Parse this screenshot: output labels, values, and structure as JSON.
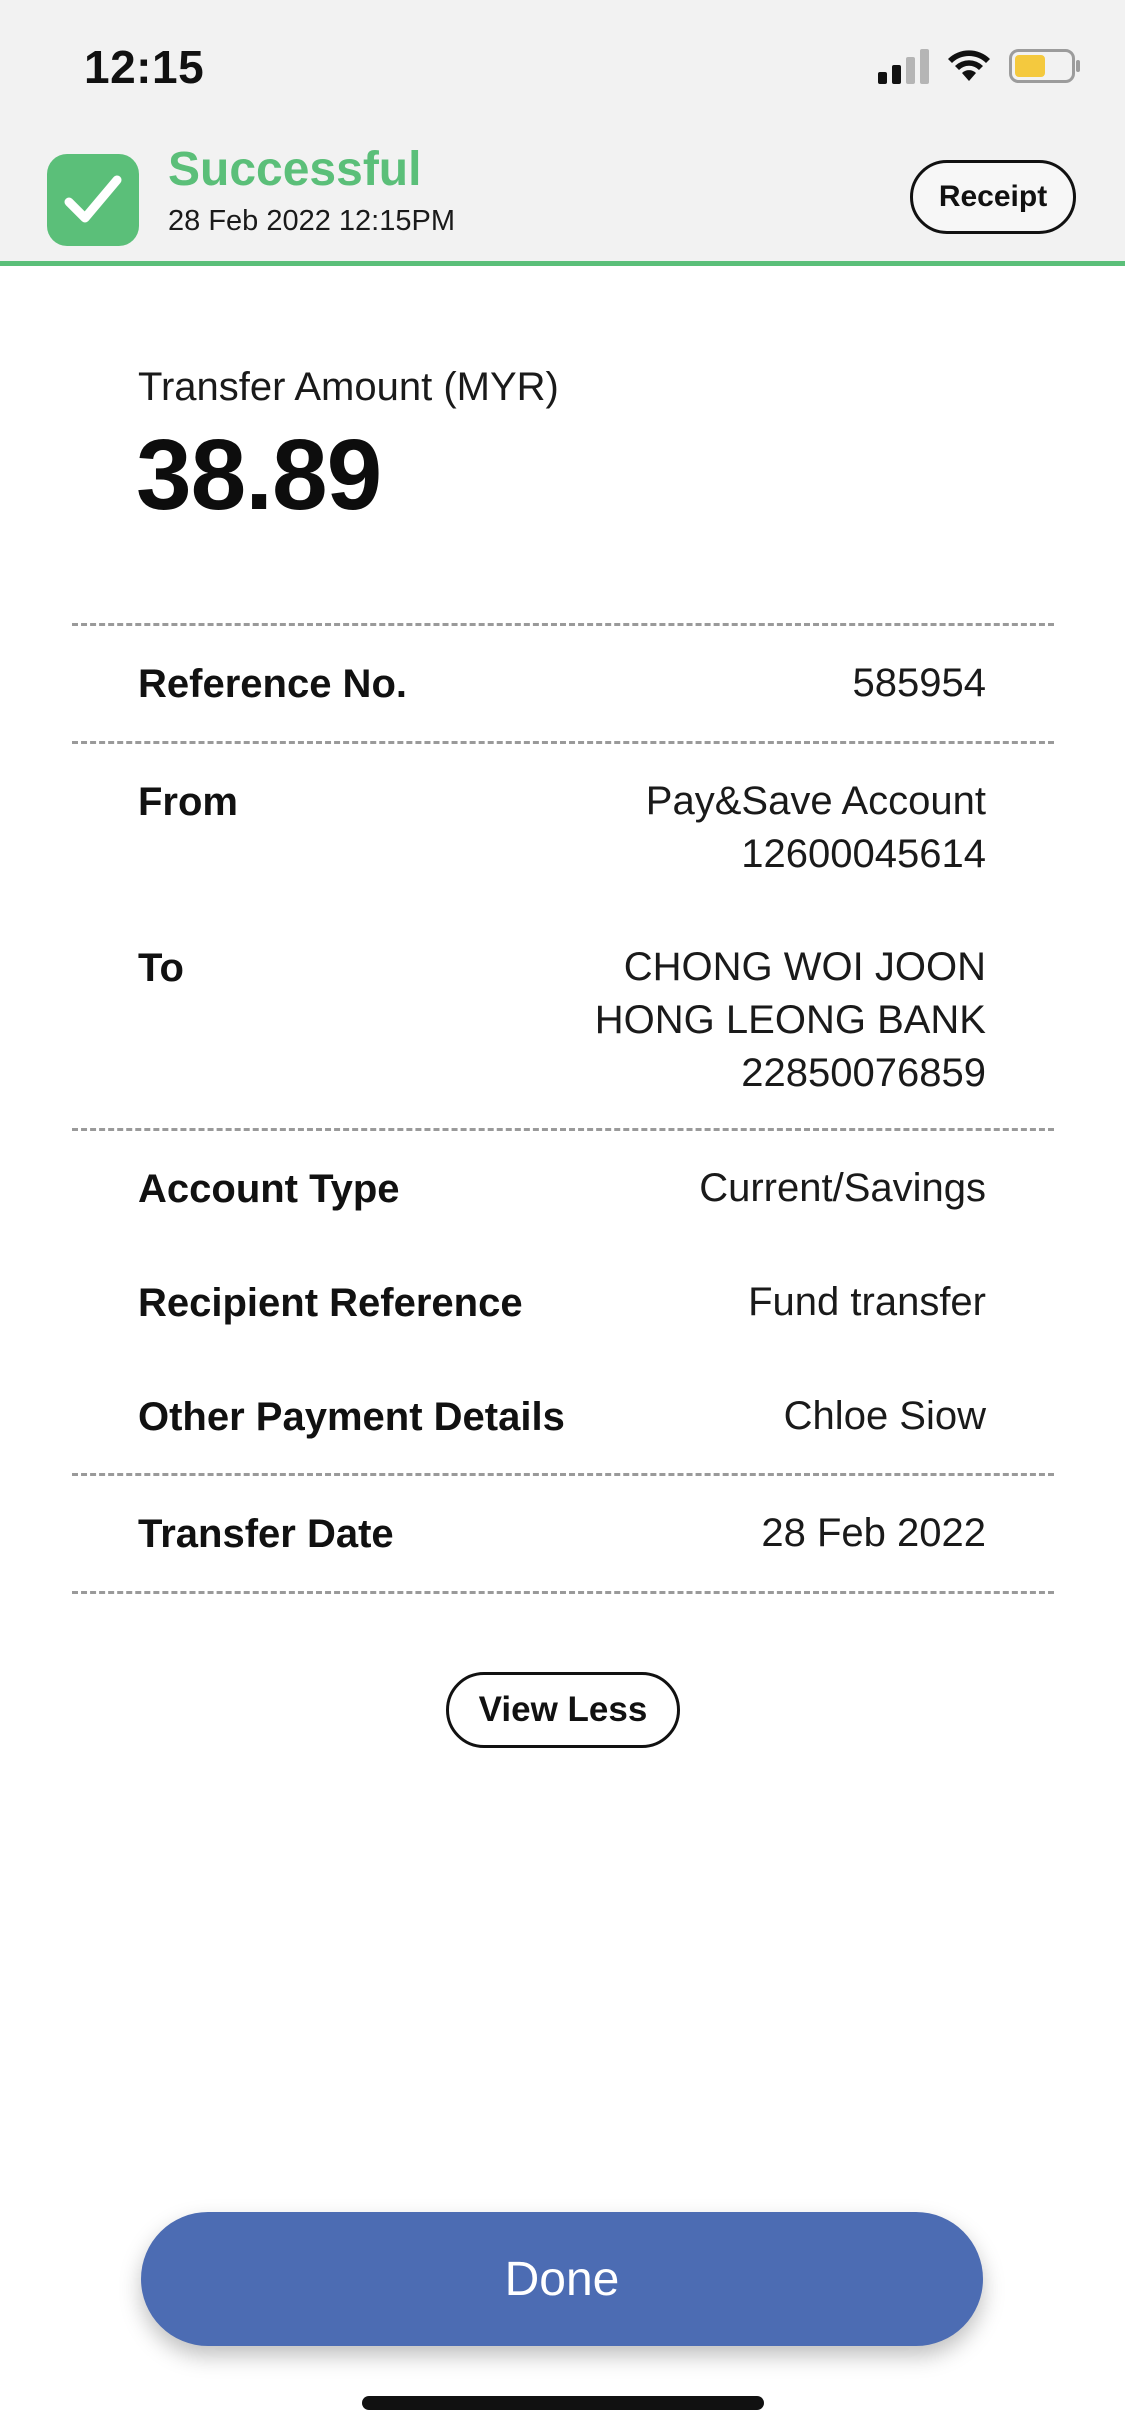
{
  "status_bar": {
    "time": "12:15",
    "icons": [
      "signal-icon",
      "wifi-icon",
      "battery-icon"
    ]
  },
  "header": {
    "status": "Successful",
    "datetime": "28 Feb 2022 12:15PM",
    "receipt_label": "Receipt",
    "accent_color": "#5bbf79"
  },
  "amount": {
    "label": "Transfer Amount (MYR)",
    "value": "38.89"
  },
  "details": {
    "reference": {
      "label": "Reference No.",
      "value": "585954"
    },
    "from": {
      "label": "From",
      "lines": [
        "Pay&Save Account",
        "12600045614"
      ]
    },
    "to": {
      "label": "To",
      "lines": [
        "CHONG WOI JOON",
        "HONG LEONG BANK",
        "22850076859"
      ]
    },
    "account_type": {
      "label": "Account Type",
      "value": "Current/Savings"
    },
    "recipient_reference": {
      "label": "Recipient Reference",
      "value": "Fund transfer"
    },
    "other_payment_details": {
      "label": "Other Payment Details",
      "value": "Chloe Siow"
    },
    "transfer_date": {
      "label": "Transfer Date",
      "value": "28 Feb 2022"
    }
  },
  "actions": {
    "view_less_label": "View Less",
    "done_label": "Done",
    "done_color": "#4c6cb3"
  }
}
